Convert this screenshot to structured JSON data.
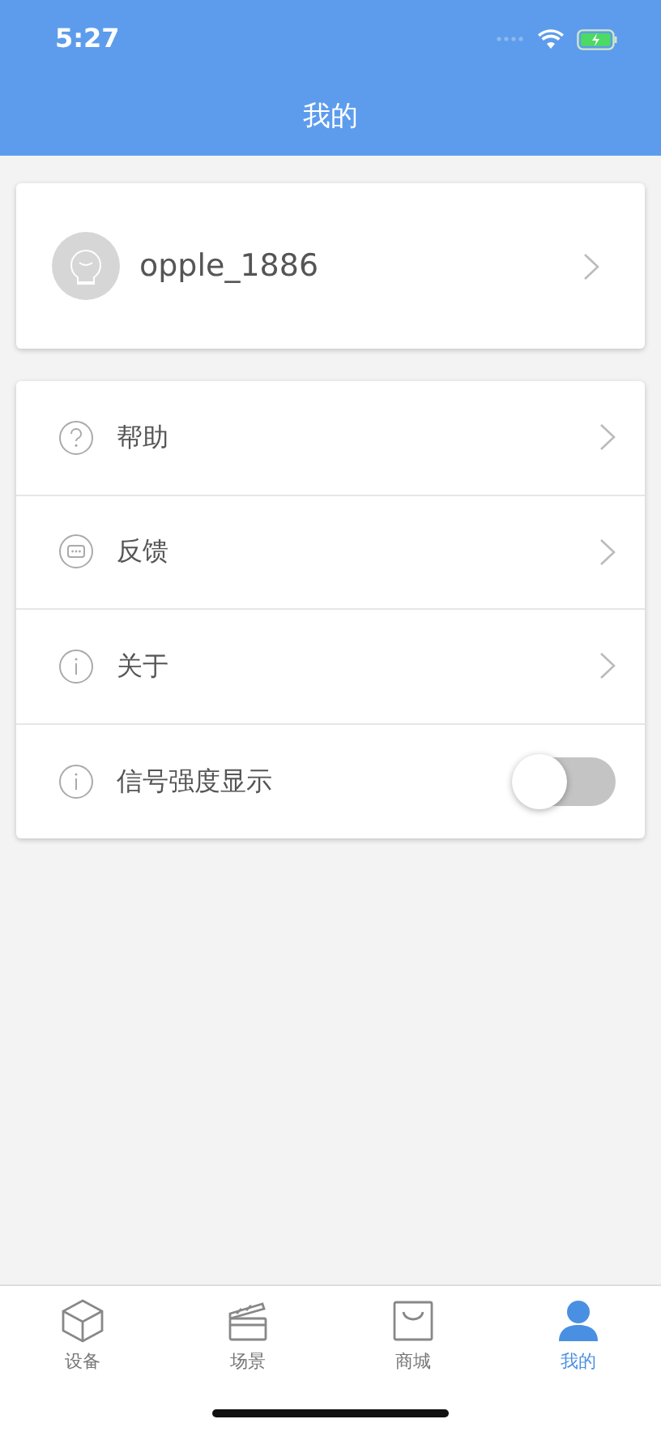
{
  "status_bar": {
    "time": "5:27"
  },
  "header": {
    "title": "我的"
  },
  "profile": {
    "username": "opple_1886"
  },
  "menu": [
    {
      "kind": "link",
      "label": "帮助"
    },
    {
      "kind": "link",
      "label": "反馈"
    },
    {
      "kind": "link",
      "label": "关于"
    },
    {
      "kind": "toggle",
      "label": "信号强度显示",
      "on": false
    }
  ],
  "tab_bar": [
    {
      "label": "设备",
      "selected": false
    },
    {
      "label": "场景",
      "selected": false
    },
    {
      "label": "商城",
      "selected": false
    },
    {
      "label": "我的",
      "selected": true
    }
  ]
}
